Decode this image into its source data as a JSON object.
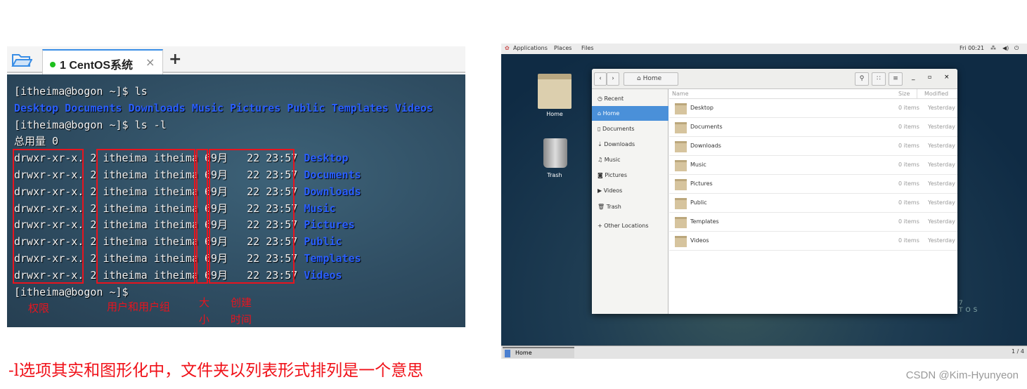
{
  "terminal": {
    "tab_label": "1 CentOS系统",
    "tab_close": "×",
    "new_tab": "+",
    "lines": [
      {
        "text": "[itheima@bogon ~]$ ls"
      },
      {
        "dirs": [
          "Desktop",
          "Documents",
          "Downloads",
          "Music",
          "Pictures",
          "Public",
          "Templates",
          "Videos"
        ]
      },
      {
        "text": "[itheima@bogon ~]$ ls -l"
      },
      {
        "text": "总用量 0"
      }
    ],
    "entries": [
      {
        "perm": "drwxr-xr-x.",
        "links": "2",
        "user": "itheima",
        "group": "itheima",
        "size": "6",
        "month": "9月",
        "day": "22",
        "time": "23:57",
        "name": "Desktop"
      },
      {
        "perm": "drwxr-xr-x.",
        "links": "2",
        "user": "itheima",
        "group": "itheima",
        "size": "6",
        "month": "9月",
        "day": "22",
        "time": "23:57",
        "name": "Documents"
      },
      {
        "perm": "drwxr-xr-x.",
        "links": "2",
        "user": "itheima",
        "group": "itheima",
        "size": "6",
        "month": "9月",
        "day": "22",
        "time": "23:57",
        "name": "Downloads"
      },
      {
        "perm": "drwxr-xr-x.",
        "links": "2",
        "user": "itheima",
        "group": "itheima",
        "size": "6",
        "month": "9月",
        "day": "22",
        "time": "23:57",
        "name": "Music"
      },
      {
        "perm": "drwxr-xr-x.",
        "links": "2",
        "user": "itheima",
        "group": "itheima",
        "size": "6",
        "month": "9月",
        "day": "22",
        "time": "23:57",
        "name": "Pictures"
      },
      {
        "perm": "drwxr-xr-x.",
        "links": "2",
        "user": "itheima",
        "group": "itheima",
        "size": "6",
        "month": "9月",
        "day": "22",
        "time": "23:57",
        "name": "Public"
      },
      {
        "perm": "drwxr-xr-x.",
        "links": "2",
        "user": "itheima",
        "group": "itheima",
        "size": "6",
        "month": "9月",
        "day": "22",
        "time": "23:57",
        "name": "Templates"
      },
      {
        "perm": "drwxr-xr-x.",
        "links": "2",
        "user": "itheima",
        "group": "itheima",
        "size": "6",
        "month": "9月",
        "day": "22",
        "time": "23:57",
        "name": "Videos"
      }
    ],
    "last_prompt": "[itheima@bogon ~]$",
    "annotations": {
      "perm": "权限",
      "owner": "用户和用户组",
      "size_1": "大",
      "size_2": "小",
      "time_1": "创建",
      "time_2": "时间"
    }
  },
  "caption": "-l选项其实和图形化中，文件夹以列表形式排列是一个意思",
  "gnome": {
    "topbar": {
      "applications": "Applications",
      "places": "Places",
      "files": "Files",
      "clock": "Fri 00:21"
    },
    "desktop_icons": [
      {
        "label": "Home"
      },
      {
        "label": "Trash"
      }
    ],
    "files": {
      "path": "Home",
      "columns": {
        "name": "Name",
        "size": "Size",
        "modified": "Modified"
      },
      "sidebar": [
        {
          "label": "Recent",
          "icon": "clock-icon"
        },
        {
          "label": "Home",
          "icon": "home-icon",
          "active": true
        },
        {
          "label": "Documents",
          "icon": "document-icon"
        },
        {
          "label": "Downloads",
          "icon": "download-icon"
        },
        {
          "label": "Music",
          "icon": "music-icon"
        },
        {
          "label": "Pictures",
          "icon": "camera-icon"
        },
        {
          "label": "Videos",
          "icon": "video-icon"
        },
        {
          "label": "Trash",
          "icon": "trash-icon"
        },
        {
          "label": "Other Locations",
          "icon": "plus-icon"
        }
      ],
      "rows": [
        {
          "name": "Desktop",
          "size": "0 items",
          "modified": "Yesterday"
        },
        {
          "name": "Documents",
          "size": "0 items",
          "modified": "Yesterday"
        },
        {
          "name": "Downloads",
          "size": "0 items",
          "modified": "Yesterday"
        },
        {
          "name": "Music",
          "size": "0 items",
          "modified": "Yesterday"
        },
        {
          "name": "Pictures",
          "size": "0 items",
          "modified": "Yesterday"
        },
        {
          "name": "Public",
          "size": "0 items",
          "modified": "Yesterday"
        },
        {
          "name": "Templates",
          "size": "0 items",
          "modified": "Yesterday"
        },
        {
          "name": "Videos",
          "size": "0 items",
          "modified": "Yesterday"
        }
      ]
    },
    "taskbar": {
      "window": "Home",
      "workspace": "1 / 4"
    }
  },
  "watermark": "CSDN @Kim-Hyunyeon",
  "colors": {
    "annotation_red": "#e8141e",
    "dir_blue": "#2a5fff",
    "selection_blue": "#4a90d9"
  }
}
